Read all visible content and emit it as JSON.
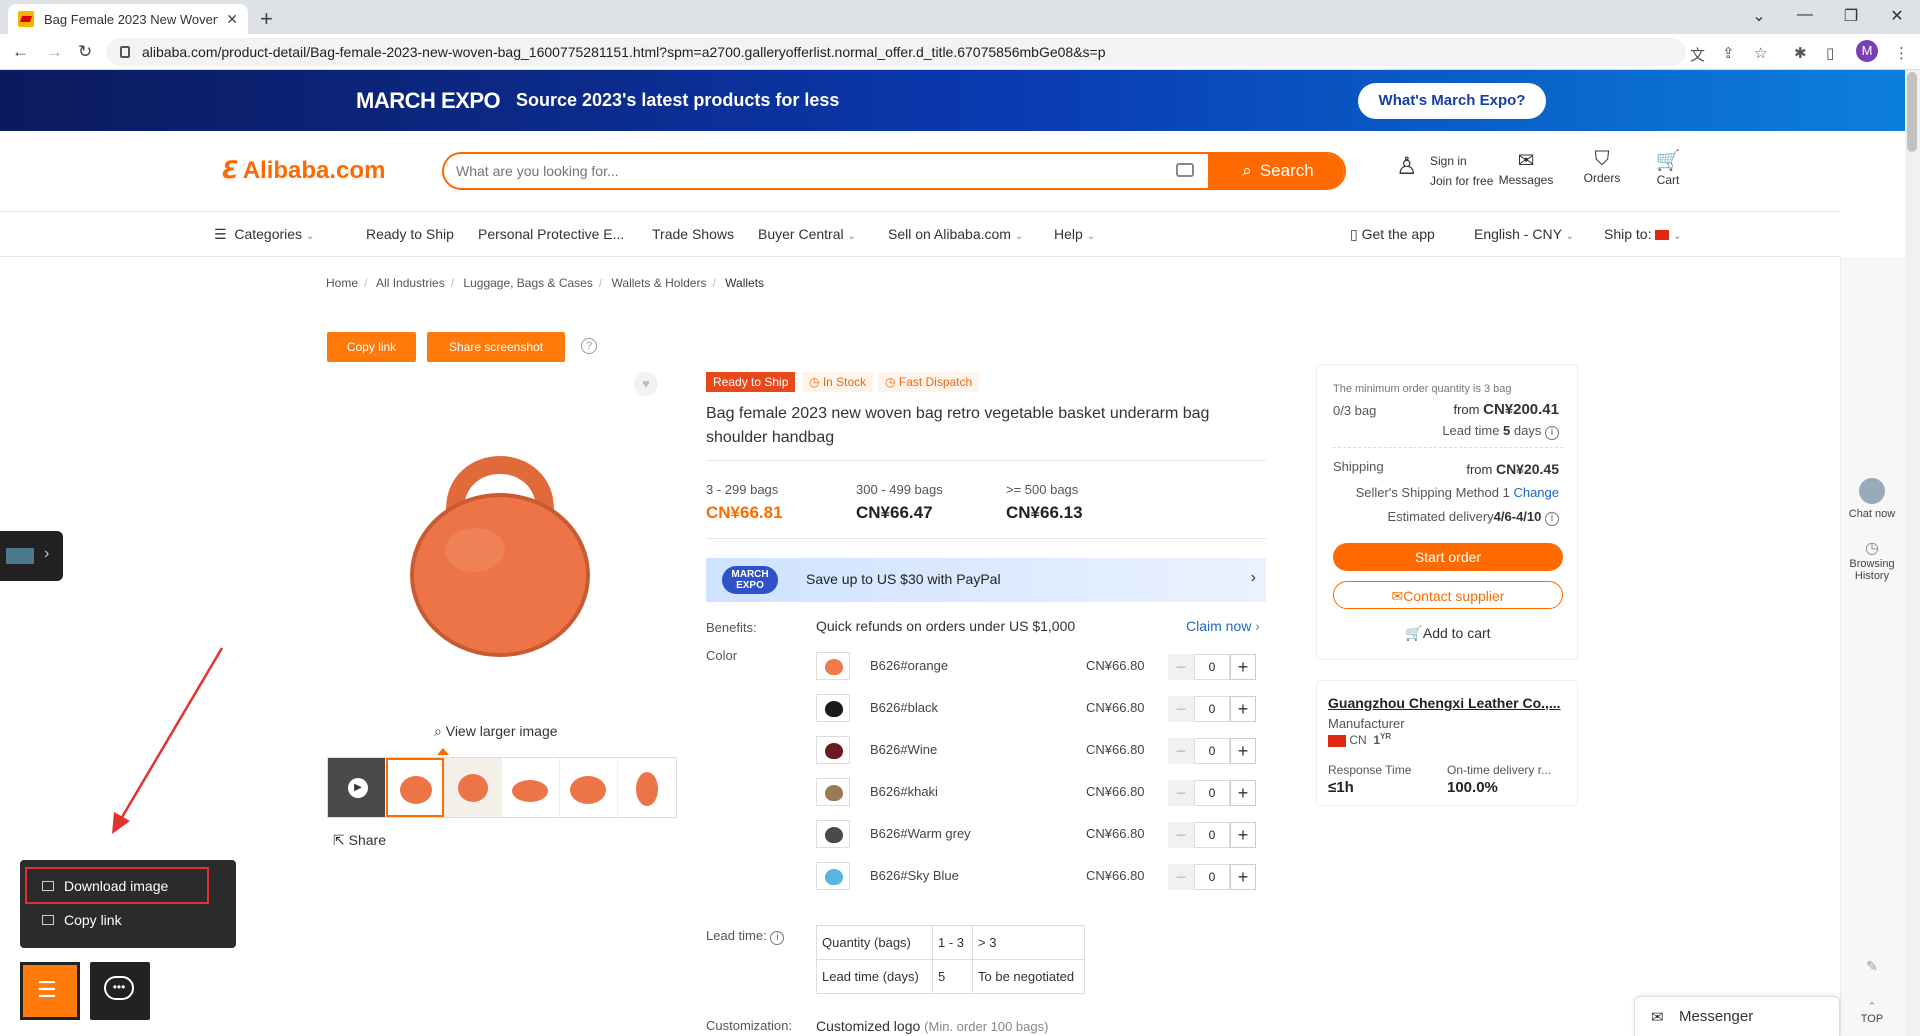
{
  "browser": {
    "tab_title": "Bag Female 2023 New Woven",
    "url": "alibaba.com/product-detail/Bag-female-2023-new-woven-bag_1600775281151.html?spm=a2700.galleryofferlist.normal_offer.d_title.67075856mbGe08&s=p",
    "profile_initial": "M"
  },
  "banner": {
    "logo": "MARCH EXPO",
    "tagline": "Source 2023's latest products for less",
    "button": "What's March Expo?"
  },
  "header": {
    "logo": "Alibaba.com",
    "search_placeholder": "What are you looking for...",
    "search_button": "Search",
    "sign_in": "Sign in",
    "join": "Join for free",
    "messages": "Messages",
    "orders": "Orders",
    "cart": "Cart"
  },
  "nav": {
    "categories": "Categories",
    "items": [
      "Ready to Ship",
      "Personal Protective E...",
      "Trade Shows",
      "Buyer Central",
      "Sell on Alibaba.com",
      "Help"
    ],
    "get_app": "Get the app",
    "language": "English - CNY",
    "ship_to": "Ship to:"
  },
  "breadcrumb": [
    "Home",
    "All Industries",
    "Luggage, Bags & Cases",
    "Wallets & Holders",
    "Wallets"
  ],
  "actions": {
    "copy_link": "Copy link",
    "share_screenshot": "Share screenshot",
    "help": "?"
  },
  "gallery": {
    "view_larger": "View larger image",
    "share": "Share"
  },
  "product": {
    "badge_ready": "Ready to Ship",
    "badge_stock": "In Stock",
    "badge_dispatch": "Fast Dispatch",
    "title": "Bag female 2023 new woven bag retro vegetable basket underarm bag shoulder handbag",
    "tiers": [
      {
        "qty": "3 - 299 bags",
        "price": "CN¥66.81"
      },
      {
        "qty": "300 - 499 bags",
        "price": "CN¥66.47"
      },
      {
        "qty": ">= 500 bags",
        "price": "CN¥66.13"
      }
    ],
    "paypal_logo": "MARCH EXPO",
    "paypal_text": "Save up to US $30 with PayPal",
    "benefits_label": "Benefits:",
    "benefits_text": "Quick refunds on orders under US $1,000",
    "claim_now": "Claim now",
    "color_label": "Color",
    "colors": [
      {
        "name": "B626#orange",
        "price": "CN¥66.80",
        "qty": "0",
        "swatch": "#f07a4a"
      },
      {
        "name": "B626#black",
        "price": "CN¥66.80",
        "qty": "0",
        "swatch": "#1a1a1a"
      },
      {
        "name": "B626#Wine",
        "price": "CN¥66.80",
        "qty": "0",
        "swatch": "#6b1a24"
      },
      {
        "name": "B626#khaki",
        "price": "CN¥66.80",
        "qty": "0",
        "swatch": "#9a7a54"
      },
      {
        "name": "B626#Warm grey",
        "price": "CN¥66.80",
        "qty": "0",
        "swatch": "#4a4a4e"
      },
      {
        "name": "B626#Sky Blue",
        "price": "CN¥66.80",
        "qty": "0",
        "swatch": "#5ab4e0"
      }
    ],
    "lead_label": "Lead time:",
    "lead_table": {
      "row1": [
        "Quantity (bags)",
        "1 - 3",
        "> 3"
      ],
      "row2": [
        "Lead time (days)",
        "5",
        "To be negotiated"
      ]
    },
    "custom_label": "Customization:",
    "custom_text": "Customized logo",
    "custom_note": "(Min. order 100 bags)"
  },
  "order": {
    "min_note": "The minimum order quantity is 3 bag",
    "progress": "0/3 bag",
    "from": "from",
    "total": "CN¥200.41",
    "lead_prefix": "Lead time",
    "lead_days": "5",
    "lead_suffix": "days",
    "shipping_label": "Shipping",
    "shipping_price": "CN¥20.45",
    "method": "Seller's Shipping Method 1",
    "change": "Change",
    "delivery_label": "Estimated delivery",
    "delivery_date": "4/6-4/10",
    "start_order": "Start order",
    "contact": "Contact supplier",
    "add_cart": "Add to cart"
  },
  "supplier": {
    "name": "Guangzhou Chengxi Leather Co.,...",
    "type": "Manufacturer",
    "country": "CN",
    "years": "1",
    "years_unit": "YR",
    "response_label": "Response Time",
    "response_value": "≤1h",
    "ontime_label": "On-time delivery r...",
    "ontime_value": "100.0%"
  },
  "rail": {
    "chat": "Chat now",
    "history": "Browsing History",
    "top": "TOP"
  },
  "popup": {
    "download": "Download image",
    "copy": "Copy link"
  },
  "messenger": "Messenger",
  "colors": {
    "accent": "#ff6a00",
    "link": "#1a66c9"
  }
}
